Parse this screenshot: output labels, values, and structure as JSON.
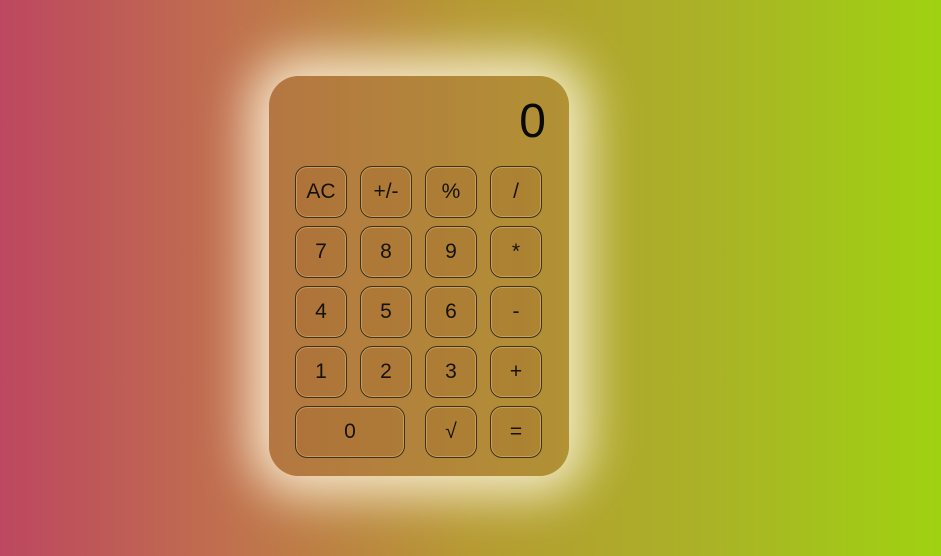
{
  "display": {
    "value": "0"
  },
  "keys": [
    {
      "label": "AC"
    },
    {
      "label": "+/-"
    },
    {
      "label": "%"
    },
    {
      "label": "/"
    },
    {
      "label": "7"
    },
    {
      "label": "8"
    },
    {
      "label": "9"
    },
    {
      "label": "*"
    },
    {
      "label": "4"
    },
    {
      "label": "5"
    },
    {
      "label": "6"
    },
    {
      "label": "-"
    },
    {
      "label": "1"
    },
    {
      "label": "2"
    },
    {
      "label": "3"
    },
    {
      "label": "+"
    },
    {
      "label": "0"
    },
    {
      "label": "√"
    },
    {
      "label": "="
    }
  ],
  "colors": {
    "background_left": "#bd4760",
    "background_right": "#9fd211",
    "calculator_body": "#b3843b",
    "glow": "#fff8e1"
  }
}
